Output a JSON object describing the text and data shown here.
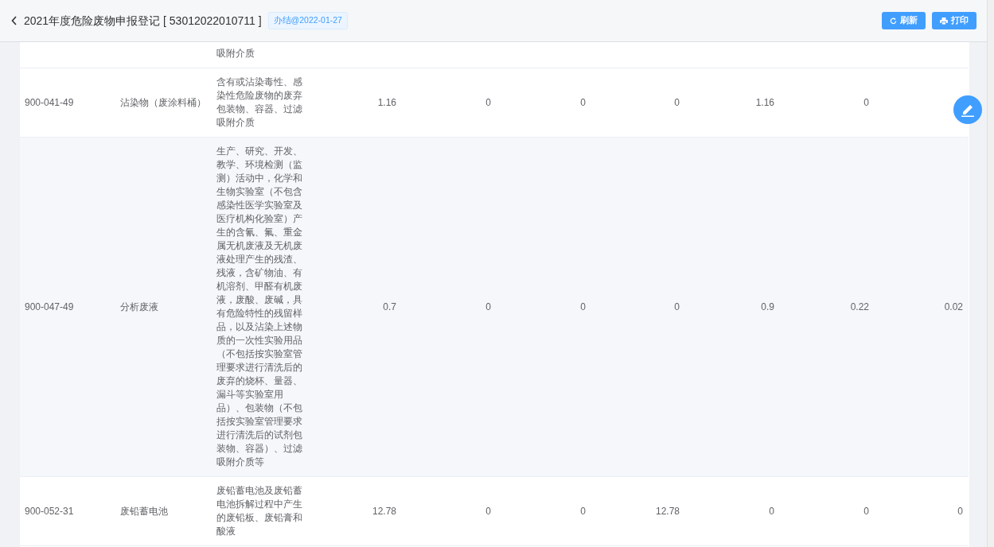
{
  "header": {
    "title": "2021年度危险废物申报登记 [ 53012022010711 ]",
    "tag": "办结@2022-01-27",
    "buttons": [
      {
        "kind": "refresh",
        "label": "刷新"
      },
      {
        "kind": "print",
        "label": "打印"
      }
    ]
  },
  "table": {
    "rows": [
      {
        "cells": [],
        "description": [
          "吸附介质"
        ]
      },
      {
        "cells": [
          "900-041-49",
          "沾染物（废涂料桶）"
        ],
        "description": [
          "含有或沾染毒性、感",
          "染性危险废物的废弃",
          "包装物、容器、过滤",
          "吸附介质"
        ],
        "numbers": [
          "1.16",
          "0",
          "0",
          "0",
          "1.16",
          "0"
        ]
      },
      {
        "cells": [
          "900-047-49",
          "分析废液"
        ],
        "description": [
          "生产、研究、开发、",
          "教学、环境检测（监",
          "测）活动中，化学和",
          "生物实验室（不包含",
          "感染性医学实验室及",
          "医疗机构化验室）产",
          "生的含氰、氟、重金",
          "属无机废液及无机废",
          "液处理产生的残渣、",
          "残液，含矿物油、有",
          "机溶剂、甲醛有机废",
          "液，废酸、废碱，具",
          "有危险特性的残留样",
          "品，以及沾染上述物",
          "质的一次性实验用品",
          "（不包括按实验室管",
          "理要求进行清洗后的",
          "废弃的烧杯、量器、",
          "漏斗等实验室用",
          "品）、包装物（不包",
          "括按实验室管理要求",
          "进行清洗后的试剂包",
          "装物、容器）、过滤",
          "吸附介质等"
        ],
        "numbers": [
          "0.7",
          "0",
          "0",
          "0",
          "0.9",
          "0.22",
          "0.02"
        ]
      },
      {
        "cells": [
          "900-052-31",
          "废铅蓄电池"
        ],
        "description": [
          "废铅蓄电池及废铅蓄",
          "电池拆解过程中产生",
          "的废铅板、废铅膏和",
          "酸液"
        ],
        "numbers": [
          "12.78",
          "0",
          "0",
          "12.78",
          "0",
          "0",
          "0"
        ]
      }
    ]
  }
}
